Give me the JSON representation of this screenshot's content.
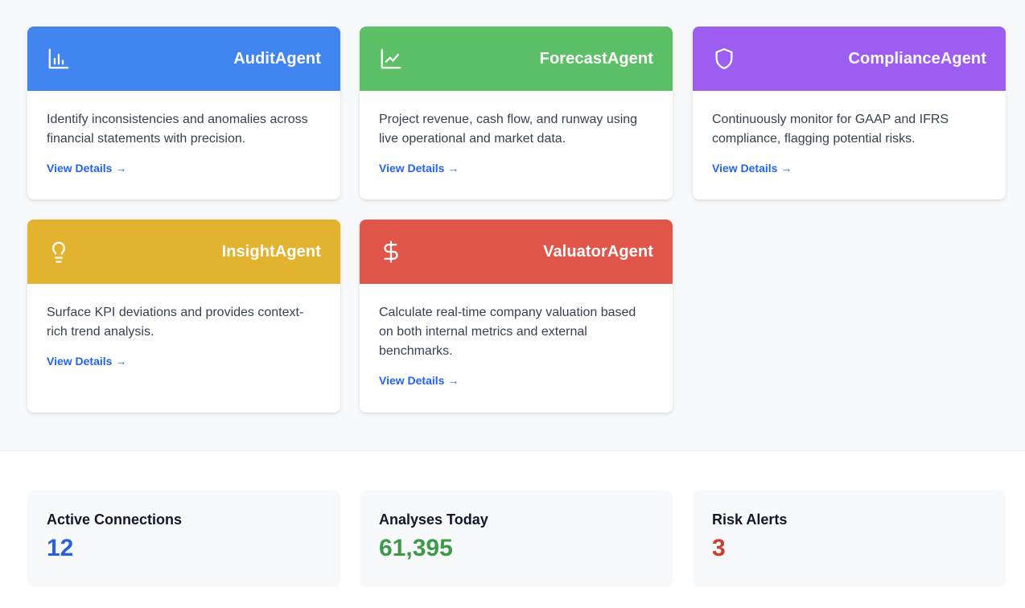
{
  "agents": [
    {
      "name": "AuditAgent",
      "icon": "bar-chart-icon",
      "color": "#4285f0",
      "description": "Identify inconsistencies and anomalies across financial statements with precision.",
      "link": "View Details →"
    },
    {
      "name": "ForecastAgent",
      "icon": "line-chart-icon",
      "color": "#5dc067",
      "description": "Project revenue, cash flow, and runway using live operational and market data.",
      "link": "View Details →"
    },
    {
      "name": "ComplianceAgent",
      "icon": "shield-icon",
      "color": "#9c5df0",
      "description": "Continuously monitor for GAAP and IFRS compliance, flagging potential risks.",
      "link": "View Details →"
    },
    {
      "name": "InsightAgent",
      "icon": "lightbulb-icon",
      "color": "#e3b22f",
      "description": "Surface KPI deviations and provides context-rich trend analysis.",
      "link": "View Details →"
    },
    {
      "name": "ValuatorAgent",
      "icon": "dollar-icon",
      "color": "#e0564b",
      "description": "Calculate real-time company valuation based on both internal metrics and external benchmarks.",
      "link": "View Details →"
    }
  ],
  "stats": [
    {
      "label": "Active Connections",
      "value": "12",
      "color": "#2b61d8"
    },
    {
      "label": "Analyses Today",
      "value": "61,395",
      "color": "#3c9a48"
    },
    {
      "label": "Risk Alerts",
      "value": "3",
      "color": "#cf3b2e"
    }
  ]
}
